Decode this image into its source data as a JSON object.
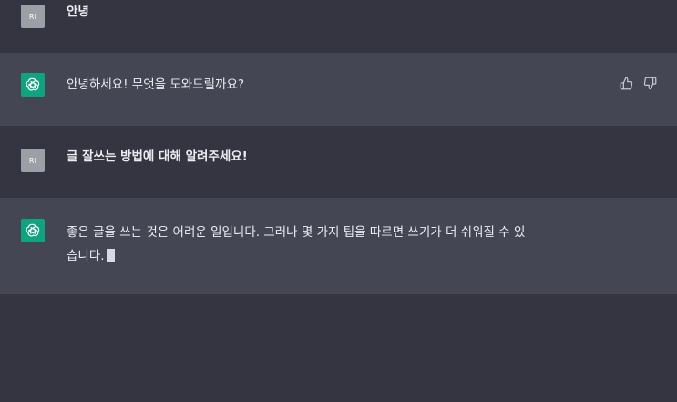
{
  "messages": [
    {
      "role": "user",
      "avatar_initials": "RI",
      "text": "안녕"
    },
    {
      "role": "assistant",
      "avatar_icon": "openai-logo-icon",
      "text": "안녕하세요! 무엇을 도와드릴까요?"
    },
    {
      "role": "user",
      "avatar_initials": "RI",
      "text": "글 잘쓰는 방법에 대해 알려주세요!"
    },
    {
      "role": "assistant",
      "avatar_icon": "openai-logo-icon",
      "text": "좋은 글을 쓰는 것은 어려운 일입니다. 그러나 몇 가지 팁을 따르면 쓰기가 더 쉬워질 수 있\n습니다."
    }
  ],
  "feedback_icons": [
    "thumbs-up-icon",
    "thumbs-down-icon"
  ],
  "colors": {
    "background": "#343541",
    "assistant_row": "#444654",
    "bot_avatar": "#10a37f",
    "user_avatar": "#9aa0a6",
    "text": "#ececf1"
  }
}
